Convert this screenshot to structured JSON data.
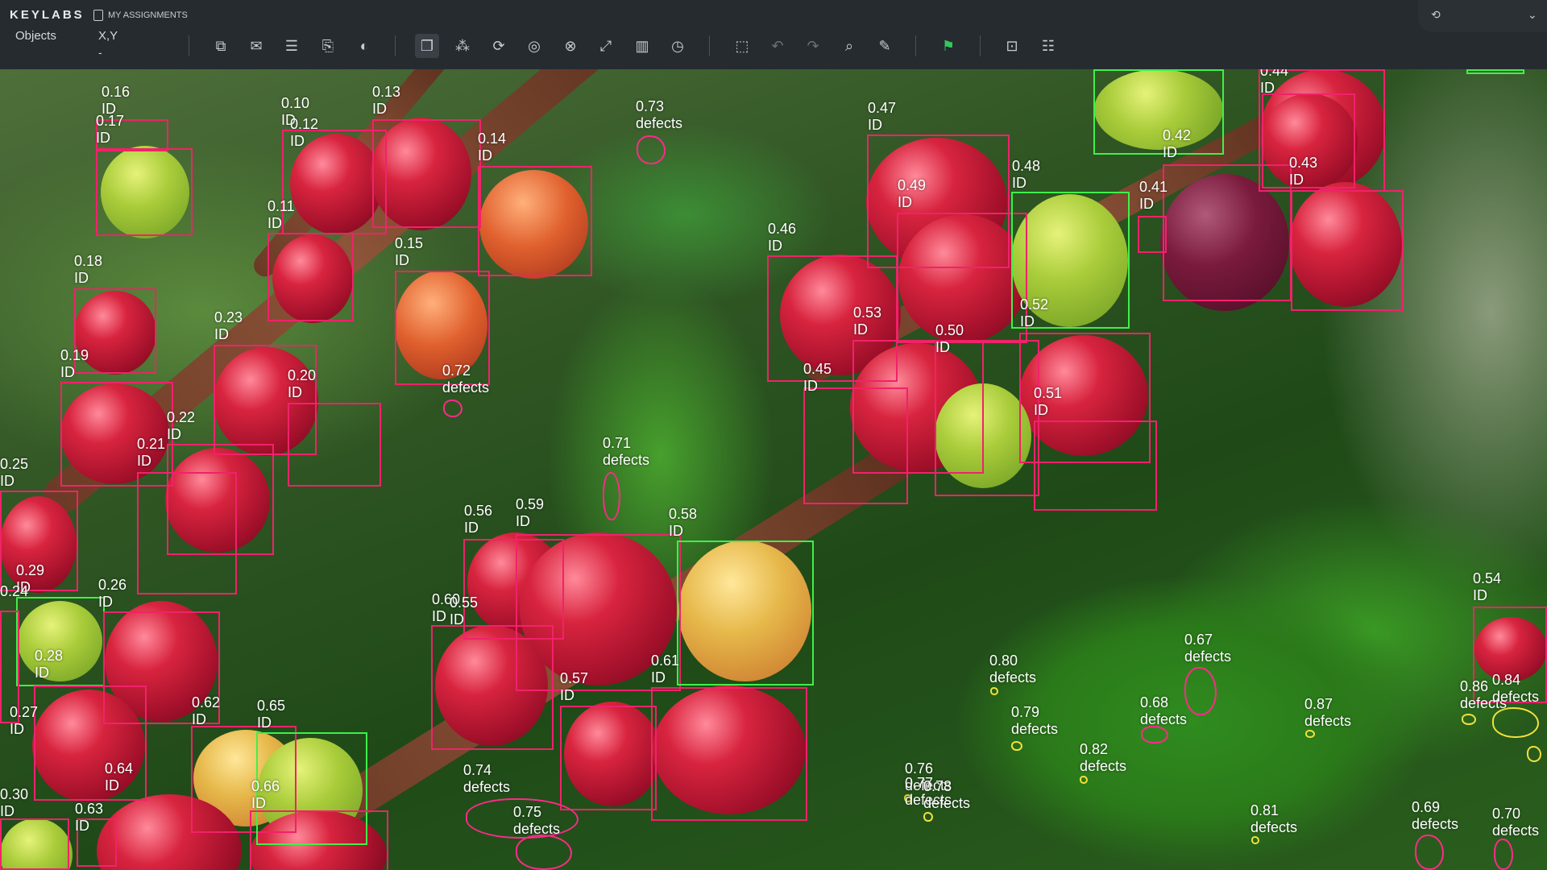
{
  "app": {
    "brand": "KEYLABS",
    "assignments": "MY ASSIGNMENTS"
  },
  "toolbar": {
    "objects_label": "Objects",
    "xy_label": "X,Y",
    "xy_value": "-",
    "tools": [
      {
        "name": "new-object-icon",
        "glyph": "⧉"
      },
      {
        "name": "comment-icon",
        "glyph": "✉"
      },
      {
        "name": "list-icon",
        "glyph": "☰"
      },
      {
        "name": "clipboard-icon",
        "glyph": "⎘"
      },
      {
        "name": "contrast-icon",
        "glyph": "◐"
      },
      {
        "name": "copy-icon",
        "glyph": "❐"
      },
      {
        "name": "keypoints-icon",
        "glyph": "⁂"
      },
      {
        "name": "rotate-icon",
        "glyph": "⟳"
      },
      {
        "name": "target-icon",
        "glyph": "◎"
      },
      {
        "name": "grid-icon",
        "glyph": "⊗"
      },
      {
        "name": "expand-icon",
        "glyph": "⤢"
      },
      {
        "name": "split-icon",
        "glyph": "▥"
      },
      {
        "name": "clock-icon",
        "glyph": "◷"
      },
      {
        "name": "select-icon",
        "glyph": "⬚"
      },
      {
        "name": "undo-icon",
        "glyph": "↶"
      },
      {
        "name": "redo-icon",
        "glyph": "↷"
      },
      {
        "name": "search-marker-icon",
        "glyph": "⌕"
      },
      {
        "name": "edit-icon",
        "glyph": "✎"
      },
      {
        "name": "flag-icon",
        "glyph": "⚑"
      },
      {
        "name": "screenshot-icon",
        "glyph": "⊡"
      },
      {
        "name": "stack-icon",
        "glyph": "☷"
      }
    ],
    "right_icon": "⟲",
    "right_chevron": "⌄"
  },
  "colors": {
    "box_red": "#f0226a",
    "box_green": "#3ff04a",
    "defect_yellow": "#f2e13a"
  },
  "annotations": [
    {
      "score": "0.16",
      "cls": "ID"
    },
    {
      "score": "0.17",
      "cls": "ID"
    },
    {
      "score": "0.10",
      "cls": "ID"
    },
    {
      "score": "0.12",
      "cls": "ID"
    },
    {
      "score": "0.13",
      "cls": "ID"
    },
    {
      "score": "0.14",
      "cls": "ID"
    },
    {
      "score": "0.11",
      "cls": "ID"
    },
    {
      "score": "0.15",
      "cls": "ID"
    },
    {
      "score": "0.18",
      "cls": "ID"
    },
    {
      "score": "0.23",
      "cls": "ID"
    },
    {
      "score": "0.20",
      "cls": "ID"
    },
    {
      "score": "0.19",
      "cls": "ID"
    },
    {
      "score": "0.22",
      "cls": "ID"
    },
    {
      "score": "0.21",
      "cls": "ID"
    },
    {
      "score": "0.25",
      "cls": "ID"
    },
    {
      "score": "0.29",
      "cls": "ID"
    },
    {
      "score": "0.24",
      "cls": "ID"
    },
    {
      "score": "0.26",
      "cls": "ID"
    },
    {
      "score": "0.28",
      "cls": "ID"
    },
    {
      "score": "0.27",
      "cls": "ID"
    },
    {
      "score": "0.30",
      "cls": "ID"
    },
    {
      "score": "0.64",
      "cls": "ID"
    },
    {
      "score": "0.62",
      "cls": "ID"
    },
    {
      "score": "0.65",
      "cls": "ID"
    },
    {
      "score": "0.66",
      "cls": "ID"
    },
    {
      "score": "0.63",
      "cls": "ID"
    },
    {
      "score": "0.73",
      "cls": "defects"
    },
    {
      "score": "0.72",
      "cls": "defects"
    },
    {
      "score": "0.71",
      "cls": "defects"
    },
    {
      "score": "0.74",
      "cls": "defects"
    },
    {
      "score": "0.75",
      "cls": "defects"
    },
    {
      "score": "0.56",
      "cls": "ID"
    },
    {
      "score": "0.59",
      "cls": "ID"
    },
    {
      "score": "0.58",
      "cls": "ID"
    },
    {
      "score": "0.60",
      "cls": "ID"
    },
    {
      "score": "0.55",
      "cls": "ID"
    },
    {
      "score": "0.57",
      "cls": "ID"
    },
    {
      "score": "0.61",
      "cls": "ID"
    },
    {
      "score": "0.47",
      "cls": "ID"
    },
    {
      "score": "0.49",
      "cls": "ID"
    },
    {
      "score": "0.48",
      "cls": "ID"
    },
    {
      "score": "0.46",
      "cls": "ID"
    },
    {
      "score": "0.53",
      "cls": "ID"
    },
    {
      "score": "0.50",
      "cls": "ID"
    },
    {
      "score": "0.52",
      "cls": "ID"
    },
    {
      "score": "0.45",
      "cls": "ID"
    },
    {
      "score": "0.51",
      "cls": "ID"
    },
    {
      "score": "0.44",
      "cls": "ID"
    },
    {
      "score": "0.42",
      "cls": "ID"
    },
    {
      "score": "0.43",
      "cls": "ID"
    },
    {
      "score": "0.41",
      "cls": "ID"
    },
    {
      "score": "0.54",
      "cls": "ID"
    },
    {
      "score": "0.67",
      "cls": "defects"
    },
    {
      "score": "0.80",
      "cls": "defects"
    },
    {
      "score": "0.68",
      "cls": "defects"
    },
    {
      "score": "0.79",
      "cls": "defects"
    },
    {
      "score": "0.82",
      "cls": "defects"
    },
    {
      "score": "0.87",
      "cls": "defects"
    },
    {
      "score": "0.86",
      "cls": "defects"
    },
    {
      "score": "0.84",
      "cls": "defects"
    },
    {
      "score": "0.76",
      "cls": "defects"
    },
    {
      "score": "0.77",
      "cls": "defects"
    },
    {
      "score": "0.78",
      "cls": "defects"
    },
    {
      "score": "0.81",
      "cls": "defects"
    },
    {
      "score": "0.69",
      "cls": "defects"
    },
    {
      "score": "0.70",
      "cls": "defects"
    }
  ]
}
